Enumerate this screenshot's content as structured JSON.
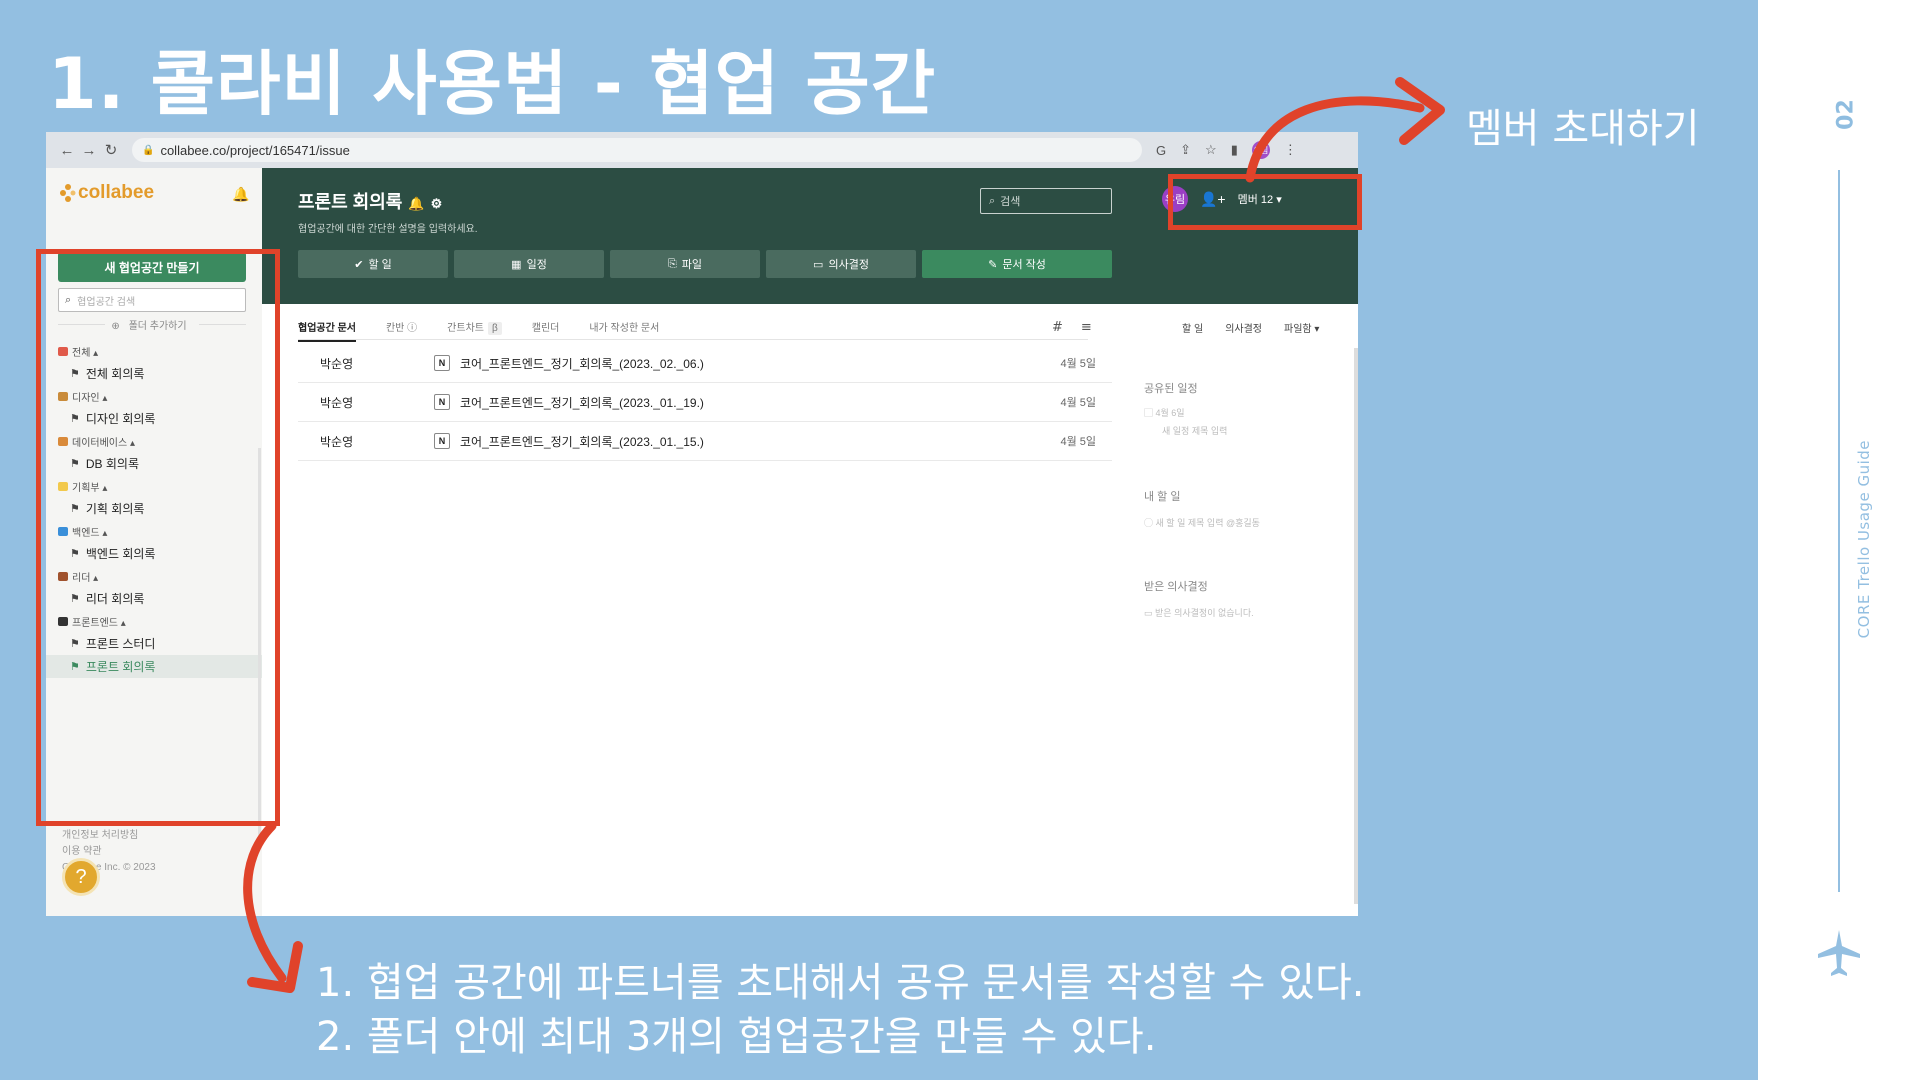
{
  "slide": {
    "title": "1. 콜라비 사용법 - 협업 공간",
    "callout": "멤버 초대하기",
    "bullets": [
      "1. 협업 공간에 파트너를 초대해서 공유 문서를 작성할 수 있다.",
      "2. 폴더 안에 최대 3개의 협업공간을 만들 수 있다."
    ],
    "page_number": "02",
    "side_caption": "CORE Trello Usage Guide",
    "accent_color": "#e0432a",
    "background_color": "#93bfe1"
  },
  "browser": {
    "url": "collabee.co/project/165471/issue",
    "avatar": "유림"
  },
  "sidebar": {
    "logo": "collabee",
    "new_workspace": "새 협업공간 만들기",
    "search_placeholder": "협업공간 검색",
    "add_folder": "폴더 추가하기",
    "folders": [
      {
        "name": "전체 ▴",
        "color": "#e05a4a",
        "items": [
          "전체 회의록"
        ]
      },
      {
        "name": "디자인 ▴",
        "color": "#c98b3a",
        "items": [
          "디자인 회의록"
        ]
      },
      {
        "name": "데이터베이스 ▴",
        "color": "#d98a3a",
        "items": [
          "DB 회의록"
        ]
      },
      {
        "name": "기획부 ▴",
        "color": "#f2c94c",
        "items": [
          "기획 회의록"
        ]
      },
      {
        "name": "백엔드 ▴",
        "color": "#3a8fd9",
        "items": [
          "백엔드 회의록"
        ]
      },
      {
        "name": "리더 ▴",
        "color": "#a0522d",
        "items": [
          "리더 회의록"
        ]
      },
      {
        "name": "프론트엔드 ▴",
        "color": "#333333",
        "items": [
          "프론트 스터디",
          "프론트 회의록"
        ]
      }
    ],
    "footer": [
      "개인정보 처리방침",
      "이용 약관",
      "Collabee Inc. © 2023"
    ],
    "help": "?"
  },
  "project": {
    "title": "프론트 회의록",
    "description": "협업공간에 대한 간단한 설명을 입력하세요.",
    "search_placeholder": "검색",
    "user_avatar": "유림",
    "member_label": "멤버 12 ▾",
    "action_tabs": [
      "할 일",
      "일정",
      "파일",
      "의사결정",
      "문서 작성"
    ],
    "doc_tabs": [
      "협업공간 문서",
      "칸반 ⓘ",
      "간트차트",
      "캘린더",
      "내가 작성한 문서"
    ],
    "beta": "β",
    "right_tabs": [
      "할 일",
      "의사결정",
      "파일함 ▾"
    ],
    "documents": [
      {
        "author": "박순영",
        "name": "코어_프론트엔드_정기_회의록_(2023._02._06.)",
        "date": "4월 5일"
      },
      {
        "author": "박순영",
        "name": "코어_프론트엔드_정기_회의록_(2023._01._19.)",
        "date": "4월 5일"
      },
      {
        "author": "박순영",
        "name": "코어_프론트엔드_정기_회의록_(2023._01._15.)",
        "date": "4월 5일"
      }
    ],
    "right_panel": {
      "schedule_title": "공유된 일정",
      "schedule_date": "4월 6일",
      "schedule_placeholder": "새 일정 제목 입력",
      "todo_title": "내 할 일",
      "todo_placeholder": "새 할 일 제목 입력 @홍길동",
      "decision_title": "받은 의사결정",
      "decision_empty": "받은 의사결정이 없습니다."
    }
  }
}
